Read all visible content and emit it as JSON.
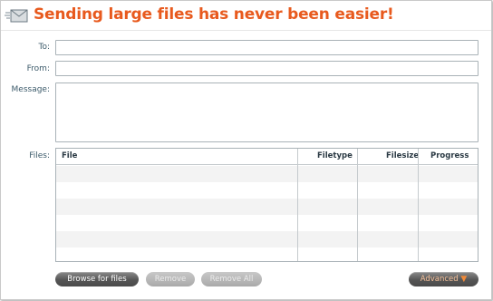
{
  "header": {
    "title": "Sending large files has never been easier!",
    "icon": "mail-icon"
  },
  "form": {
    "to_label": "To:",
    "to_value": "",
    "from_label": "From:",
    "from_value": "",
    "message_label": "Message:",
    "message_value": "",
    "files_label": "Files:"
  },
  "files_table": {
    "columns": [
      "File",
      "Filetype",
      "Filesize",
      "Progress"
    ],
    "rows": []
  },
  "buttons": {
    "browse": "Browse for files",
    "remove": "Remove",
    "remove_all": "Remove All",
    "advanced": "Advanced",
    "advanced_arrow": "▼"
  },
  "colors": {
    "title": "#e85a1e",
    "label": "#3d5b6b",
    "button_dark": "#555555",
    "button_disabled": "#a9a9a9",
    "accent_arrow": "#f08a3a"
  }
}
